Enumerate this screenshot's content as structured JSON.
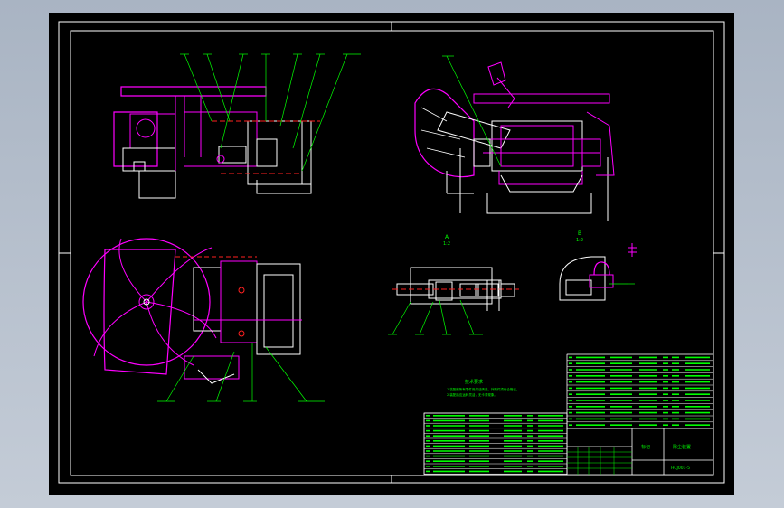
{
  "app": {
    "viewport_bg": "#000000",
    "frame_color": "#ffffff",
    "colors": {
      "magenta": "#ff00ff",
      "green": "#00ff00",
      "white": "#ffffff",
      "red": "#ff2020",
      "cyan": "#00ffff",
      "yellow": "#ffff00"
    }
  },
  "drawing": {
    "notes_heading": "技术要求",
    "notes_lines": [
      "1.装配前所有零件用煤油清洗，外购件须有合格证。",
      "2.装配后应运转灵活，无卡滞现象。"
    ],
    "title_block": {
      "drawing_title": "除尘装置",
      "label_a": "标记",
      "drawing_no": "HCJ001-5"
    },
    "section_marks": [
      "A",
      "1:2",
      "B",
      "1:2"
    ]
  }
}
